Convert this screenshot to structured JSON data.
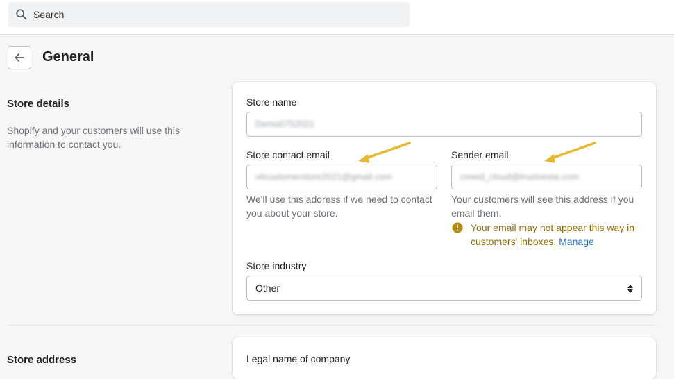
{
  "topbar": {
    "search_placeholder": "Search",
    "search_icon": "search-icon"
  },
  "header": {
    "back_icon": "arrow-left-icon",
    "title": "General"
  },
  "store_details": {
    "title": "Store details",
    "description": "Shopify and your customers will use this information to contact you.",
    "store_name": {
      "label": "Store name",
      "value": "Demo0752021"
    },
    "contact_email": {
      "label": "Store contact email",
      "value": "vitcustomerstore2021@gmail.com",
      "help": "We'll use this address if we need to contact you about your store."
    },
    "sender_email": {
      "label": "Sender email",
      "value": "cmeid_cloud@trustvesta.com",
      "help": "Your customers will see this address if you email them.",
      "warning": "Your email may not appear this way in customers' inboxes.",
      "warning_link": "Manage",
      "warning_icon": "alert-circle-icon"
    },
    "industry": {
      "label": "Store industry",
      "value": "Other"
    }
  },
  "store_address": {
    "title": "Store address",
    "legal_name_label": "Legal name of company"
  },
  "annotation_color": "#e8b830",
  "warning_color": "#916a00",
  "link_color": "#2c6ecb"
}
